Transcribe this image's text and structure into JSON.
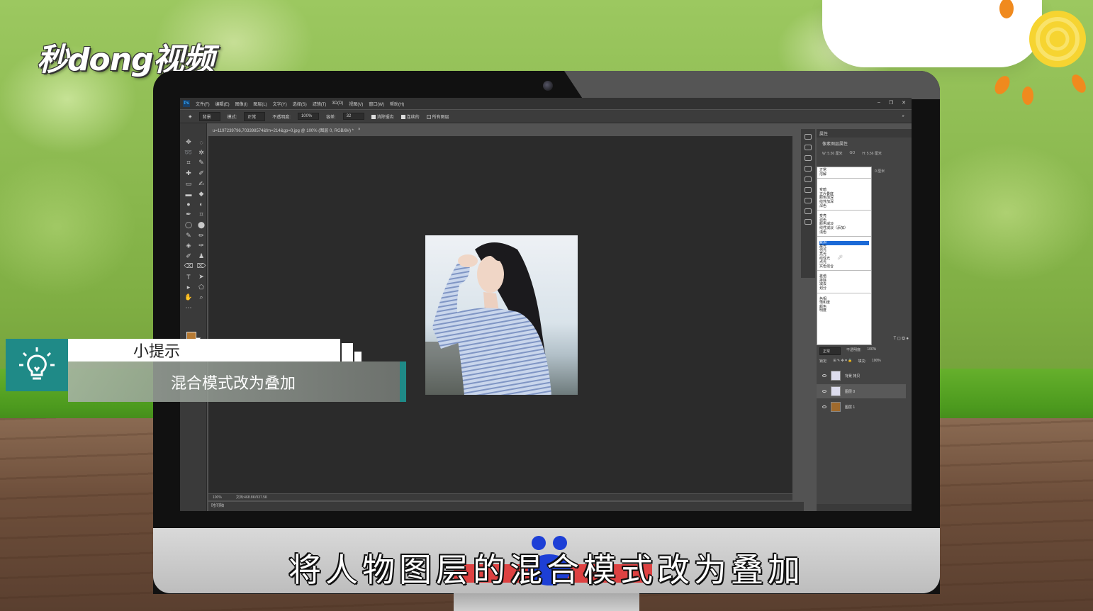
{
  "watermark": {
    "logo_text": "秒dong视频"
  },
  "photoshop": {
    "menu": [
      "文件(F)",
      "编辑(E)",
      "图像(I)",
      "图层(L)",
      "文字(Y)",
      "选择(S)",
      "滤镜(T)",
      "3D(D)",
      "视图(V)",
      "窗口(W)",
      "帮助(H)"
    ],
    "options": {
      "tool_preset": "背景",
      "mode_label": "模式:",
      "mode_value": "正常",
      "opacity_label": "不透明度:",
      "opacity_value": "100%",
      "tolerance_label": "容差:",
      "tolerance_value": "32",
      "antialias_label": "消除锯齿",
      "contiguous_label": "连续的",
      "all_layers_label": "所有图层"
    },
    "document_tab": "u=1197239796,703398574&fm=214&gp=0.jpg @ 100% (图层 0, RGB/8#) *",
    "status": {
      "zoom": "100%",
      "doc_size": "文档:468.8K/937.5K"
    },
    "timeline_label": "时间轴",
    "properties": {
      "panel_title": "属性",
      "subtitle": "像素图层属性",
      "w_label": "W: 5.56 厘米",
      "go_label": "GO",
      "h_label": "H: 5.56 厘米",
      "x_label": "0 厘米"
    },
    "blend_modes": [
      [
        "正常",
        "溶解"
      ],
      [
        "变暗",
        "正片叠底",
        "颜色加深",
        "线性加深",
        "深色"
      ],
      [
        "变亮",
        "滤色",
        "颜色减淡",
        "线性减淡（添加）",
        "浅色"
      ],
      [
        "叠加",
        "柔光",
        "强光",
        "亮光",
        "线性光",
        "点光",
        "实色混合"
      ],
      [
        "差值",
        "排除",
        "减去",
        "划分"
      ],
      [
        "色相",
        "饱和度",
        "颜色",
        "明度"
      ]
    ],
    "selected_blend": "叠加",
    "layers": {
      "blend_value": "正常",
      "opacity_label": "不透明度:",
      "opacity_value": "100%",
      "lock_label": "锁定:",
      "fill_label": "填充:",
      "fill_value": "100%",
      "items": [
        {
          "name": "背景 拷贝"
        },
        {
          "name": "图层 0"
        },
        {
          "name": "图层 1"
        }
      ]
    }
  },
  "tip": {
    "title": "小提示",
    "body": "混合模式改为叠加"
  },
  "caption": "将人物图层的混合模式改为叠加",
  "colors": {
    "teal": "#1f8a87",
    "swatch_foreground": "#b67a33",
    "selection_blue": "#1b6ad7"
  }
}
